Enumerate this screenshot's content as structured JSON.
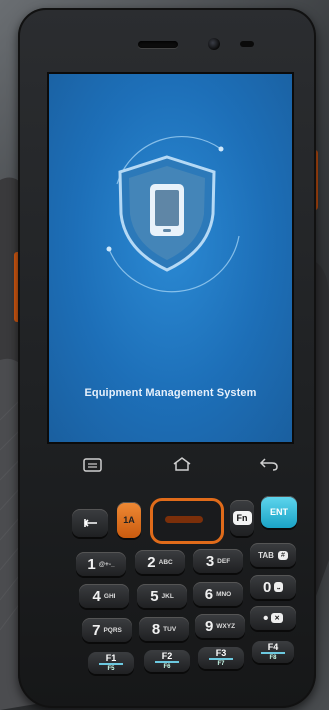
{
  "screen": {
    "app_title": "Equipment Management System",
    "logo_icon": "shield-tablet-icon",
    "accent_color": "#1d6fb8"
  },
  "navbar": {
    "menu_icon": "menu-icon",
    "home_icon": "home-icon",
    "back_icon": "back-icon"
  },
  "keys": {
    "alpha": "1A",
    "fn": "Fn",
    "ent": "ENT",
    "tab": "TAB",
    "k1": {
      "main": "1",
      "sub": "@+-_"
    },
    "k2": {
      "main": "2",
      "sub": "ABC"
    },
    "k3": {
      "main": "3",
      "sub": "DEF"
    },
    "k4": {
      "main": "4",
      "sub": "GHI"
    },
    "k5": {
      "main": "5",
      "sub": "JKL"
    },
    "k6": {
      "main": "6",
      "sub": "MNO"
    },
    "k7": {
      "main": "7",
      "sub": "PQRS"
    },
    "k8": {
      "main": "8",
      "sub": "TUV"
    },
    "k9": {
      "main": "9",
      "sub": "WXYZ"
    },
    "k0": {
      "main": "0",
      "sub": "⎵"
    },
    "dot": {
      "main": "•",
      "sub": "✕"
    }
  },
  "fkeys": [
    {
      "label": "F1",
      "sub": "F5"
    },
    {
      "label": "F2",
      "sub": "F6"
    },
    {
      "label": "F3",
      "sub": "F7"
    },
    {
      "label": "F4",
      "sub": "F8"
    }
  ]
}
